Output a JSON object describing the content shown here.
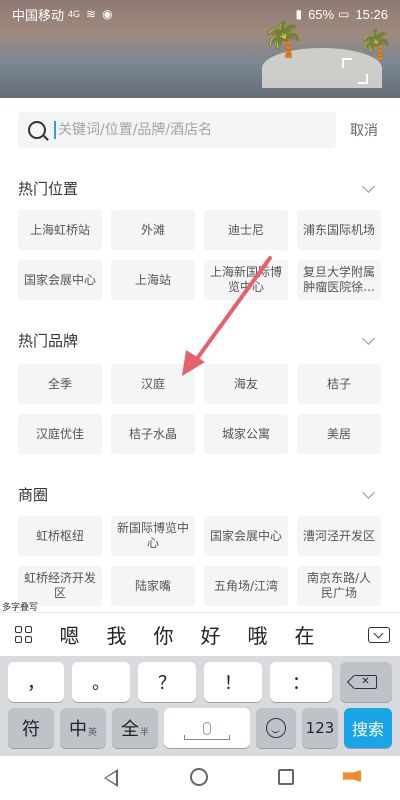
{
  "status_bar": {
    "carrier": "中国移动",
    "network": "4G",
    "battery": "65%",
    "time": "15:26"
  },
  "search": {
    "placeholder": "关键词/位置/品牌/酒店名",
    "cancel_label": "取消"
  },
  "sections": [
    {
      "title": "热门位置",
      "items": [
        "上海虹桥站",
        "外滩",
        "迪士尼",
        "浦东国际机场",
        "国家会展中心",
        "上海站",
        "上海新国际博览中心",
        "复旦大学附属肿瘤医院徐..."
      ]
    },
    {
      "title": "热门品牌",
      "items": [
        "全季",
        "汉庭",
        "海友",
        "桔子",
        "汉庭优佳",
        "桔子水晶",
        "城家公寓",
        "美居"
      ]
    },
    {
      "title": "商圈",
      "items": [
        "虹桥枢纽",
        "新国际博览中心",
        "国家会展中心",
        "漕河泾开发区",
        "虹桥经济开发区",
        "陆家嘴",
        "五角场/江湾",
        "南京东路/人民广场"
      ]
    }
  ],
  "keyboard": {
    "mode_label": "多字叠写",
    "candidates": [
      "嗯",
      "我",
      "你",
      "好",
      "哦",
      "在"
    ],
    "row1": [
      "，",
      "。",
      "？",
      "！",
      "："
    ],
    "row2": {
      "symbols": "符",
      "chinese": "中",
      "chinese_sub": "英",
      "full": "全",
      "full_sub": "半",
      "numbers": "123",
      "search": "搜索"
    }
  },
  "colors": {
    "accent": "#1aa5e8",
    "arrow": "#e8606a",
    "chip_bg": "#f4f5f7"
  }
}
